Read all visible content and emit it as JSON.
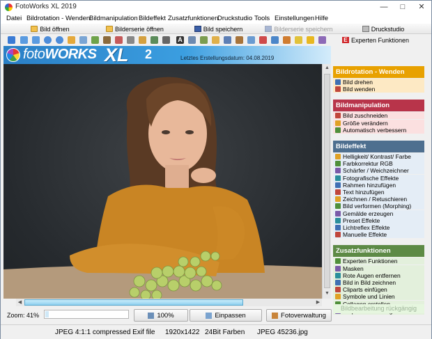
{
  "window": {
    "title": "FotoWorks XL 2019"
  },
  "menu": [
    "Datei",
    "Bildrotation - Wenden",
    "Bildmanipulation",
    "Bildeffekt",
    "Zusatzfunktionen",
    "Druckstudio",
    "Tools",
    "Einstellungen",
    "Hilfe"
  ],
  "toolbar": {
    "bild_oeffnen": "Bild öffnen",
    "bilderserie_oeffnen": "Bilderserie öffnen",
    "bild_speichern": "Bild speichern",
    "bilderserie_speichern": "Bilderserie speichern",
    "druckstudio": "Druckstudio",
    "experten": "Experten Funktionen",
    "experten_badge": "E"
  },
  "banner": {
    "logo_foto": "foto",
    "logo_works": "WORKS",
    "logo_xl": "XL",
    "logo_num": "2",
    "date_text": "Letztes Erstellungsdatum: 04.08.2019"
  },
  "bottom": {
    "zoom_label": "Zoom: 41%",
    "zoom_fraction": 0.41,
    "btn_100": "100%",
    "btn_einpassen": "Einpassen",
    "btn_fotoverwaltung": "Fotoverwaltung"
  },
  "status": {
    "format": "JPEG 4:1:1 compressed Exif file",
    "resolution": "1920x1422",
    "colors": "24Bit Farben",
    "filename": "JPEG 45236.jpg"
  },
  "panel": {
    "sections": [
      {
        "title": "Bildrotation - Wenden",
        "color": "#e8a100",
        "items": [
          "Bild drehen",
          "Bild wenden"
        ]
      },
      {
        "title": "Bildmanipulation",
        "color": "#b8344a",
        "items": [
          "Bild zuschneiden",
          "Größe verändern",
          "Automatisch verbessern"
        ]
      },
      {
        "title": "Bildeffekt",
        "color": "#4e6f8f",
        "items": [
          "Helligkeit/ Kontrast/ Farbe",
          "Farbkorrektur RGB",
          "Schärfer / Weichzeichner",
          "Fotografische Effekte",
          "Rahmen hinzufügen",
          "Text hinzufügen",
          "Zeichnen / Retuschieren",
          "Bild verformen (Morphing)",
          "Gemälde erzeugen",
          "Preset Effekte",
          "Lichtreflex Effekte",
          "Manuelle Effekte"
        ]
      },
      {
        "title": "Zusatzfunktionen",
        "color": "#5d8a45",
        "items": [
          "Experten Funktionen",
          "Masken",
          "Rote Augen entfernen",
          "Bild in Bild zeichnen",
          "Cliparts einfügen",
          "Symbole und Linien",
          "Collagen erstellen",
          "Stapelverarbeitung"
        ]
      }
    ],
    "undo": "Bildbearbeitung rückgängig"
  }
}
